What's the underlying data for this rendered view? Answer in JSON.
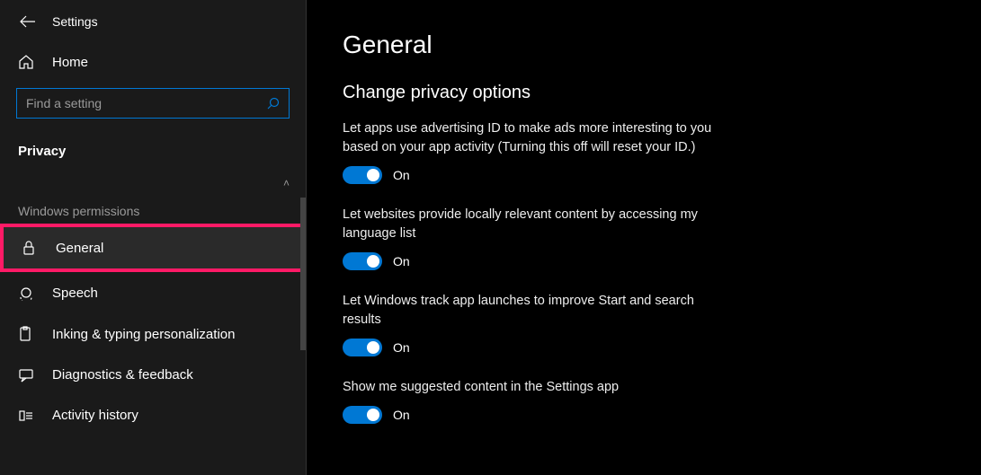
{
  "app": {
    "title": "Settings"
  },
  "sidebar": {
    "home_label": "Home",
    "search_placeholder": "Find a setting",
    "category_label": "Privacy",
    "section_header": "Windows permissions",
    "items": [
      {
        "label": "General"
      },
      {
        "label": "Speech"
      },
      {
        "label": "Inking & typing personalization"
      },
      {
        "label": "Diagnostics & feedback"
      },
      {
        "label": "Activity history"
      }
    ]
  },
  "main": {
    "title": "General",
    "subtitle": "Change privacy options",
    "toggles": [
      {
        "label": "Let apps use advertising ID to make ads more interesting to you based on your app activity (Turning this off will reset your ID.)",
        "state": "On"
      },
      {
        "label": "Let websites provide locally relevant content by accessing my language list",
        "state": "On"
      },
      {
        "label": "Let Windows track app launches to improve Start and search results",
        "state": "On"
      },
      {
        "label": "Show me suggested content in the Settings app",
        "state": "On"
      }
    ]
  },
  "colors": {
    "accent": "#0078D4",
    "highlight": "#ff1a66"
  }
}
